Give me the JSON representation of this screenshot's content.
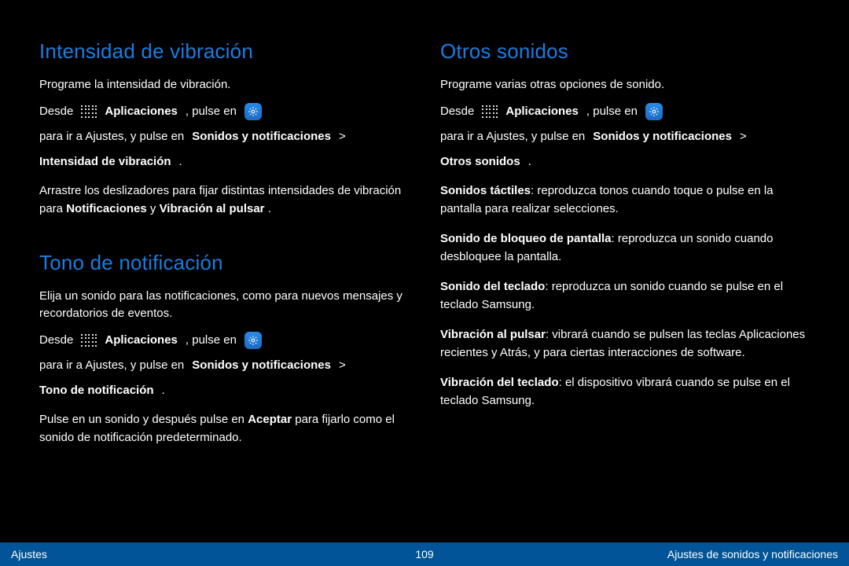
{
  "footer": {
    "left": "Ajustes",
    "page_number": "109",
    "right": "Ajustes de sonidos y notificaciones"
  },
  "sections": {
    "vibration": {
      "heading": "Intensidad de vibración",
      "intro": "Programe la intensidad de vibración.",
      "nav_prefix": "Desde ",
      "nav_apps": "Aplicaciones",
      "nav_sep1": ", pulse en",
      "nav_settings_and_tap": "para ir a Ajustes, y pulse en ",
      "nav_sounds": "Sonidos y notificaciones",
      "nav_sep2": " > ",
      "nav_item": "Intensidad de vibración",
      "desc1_prefix": "Arrastre los deslizadores para fijar distintas intensidades de vibración para ",
      "desc1_b1": "Notificaciones",
      "desc1_mid": " y ",
      "desc1_b2": "Vibración al pulsar",
      "desc1_suffix": "."
    },
    "tone": {
      "heading": "Tono de notificación",
      "intro": "Elija un sonido para las notificaciones, como para nuevos mensajes y recordatorios de eventos.",
      "nav_prefix": "Desde ",
      "nav_apps": "Aplicaciones",
      "nav_sep1": ", pulse en",
      "nav_settings_and_tap": "para ir a Ajustes, y pulse en ",
      "nav_sounds": "Sonidos y notificaciones",
      "nav_sep2": " > ",
      "nav_item": "Tono de notificación",
      "closing_prefix": "Pulse en un sonido y después pulse en ",
      "closing_bold": "Aceptar",
      "closing_suffix": " para fijarlo como el sonido de notificación predeterminado."
    },
    "other": {
      "heading": "Otros sonidos",
      "intro": "Programe varias otras opciones de sonido.",
      "nav_prefix": "Desde ",
      "nav_apps": "Aplicaciones",
      "nav_sep1": ", pulse en",
      "nav_settings_and_tap": "para ir a Ajustes, y pulse en ",
      "nav_sounds": "Sonidos y notificaciones",
      "nav_sep2": " > ",
      "nav_item": "Otros sonidos",
      "b1": "Sonidos táctiles",
      "d1": ": reproduzca tonos cuando toque o pulse en la pantalla para realizar selecciones.",
      "b2": "Sonido de bloqueo de pantalla",
      "d2": ": reproduzca un sonido cuando desbloquee la pantalla.",
      "b3": "Sonido del teclado",
      "d3": ": reproduzca un sonido cuando se pulse en el teclado Samsung.",
      "b4": "Vibración al pulsar",
      "d4": ": vibrará cuando se pulsen las teclas Aplicaciones recientes y Atrás, y para ciertas interacciones de software.",
      "b5": "Vibración del teclado",
      "d5": ": el dispositivo vibrará cuando se pulse en el teclado Samsung."
    }
  }
}
